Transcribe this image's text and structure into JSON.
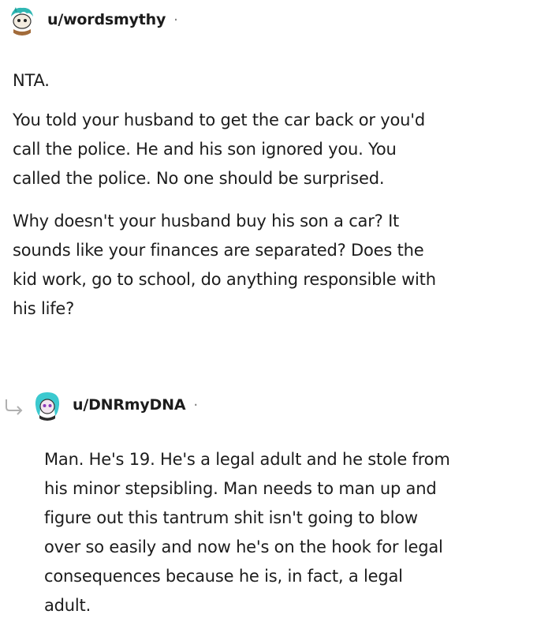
{
  "comments": [
    {
      "username": "u/wordsmythy",
      "separator": "·",
      "avatar_icon": "snoo-avatar-teal-hair",
      "paragraphs": [
        [
          "NTA."
        ],
        [
          "You told your husband to get the car back or you'd",
          "call the police. He and his son ignored you. You",
          "called the police. No one should be surprised."
        ],
        [
          "Why doesn't your husband buy his son a car? It",
          "sounds like your finances are separated? Does the",
          "kid work, go to school, do anything responsible with",
          "his life?"
        ]
      ]
    },
    {
      "username": "u/DNRmyDNA",
      "separator": "·",
      "avatar_icon": "snoo-avatar-purple-hair",
      "reply_icon": "reply-arrow-icon",
      "paragraphs": [
        [
          "Man. He's 19. He's a legal adult and he stole from",
          "his minor stepsibling. Man needs to man up and",
          "figure out this tantrum shit isn't going to blow",
          "over so easily and now he's on the hook for legal",
          "consequences because he is, in fact, a legal",
          "adult."
        ]
      ]
    }
  ]
}
